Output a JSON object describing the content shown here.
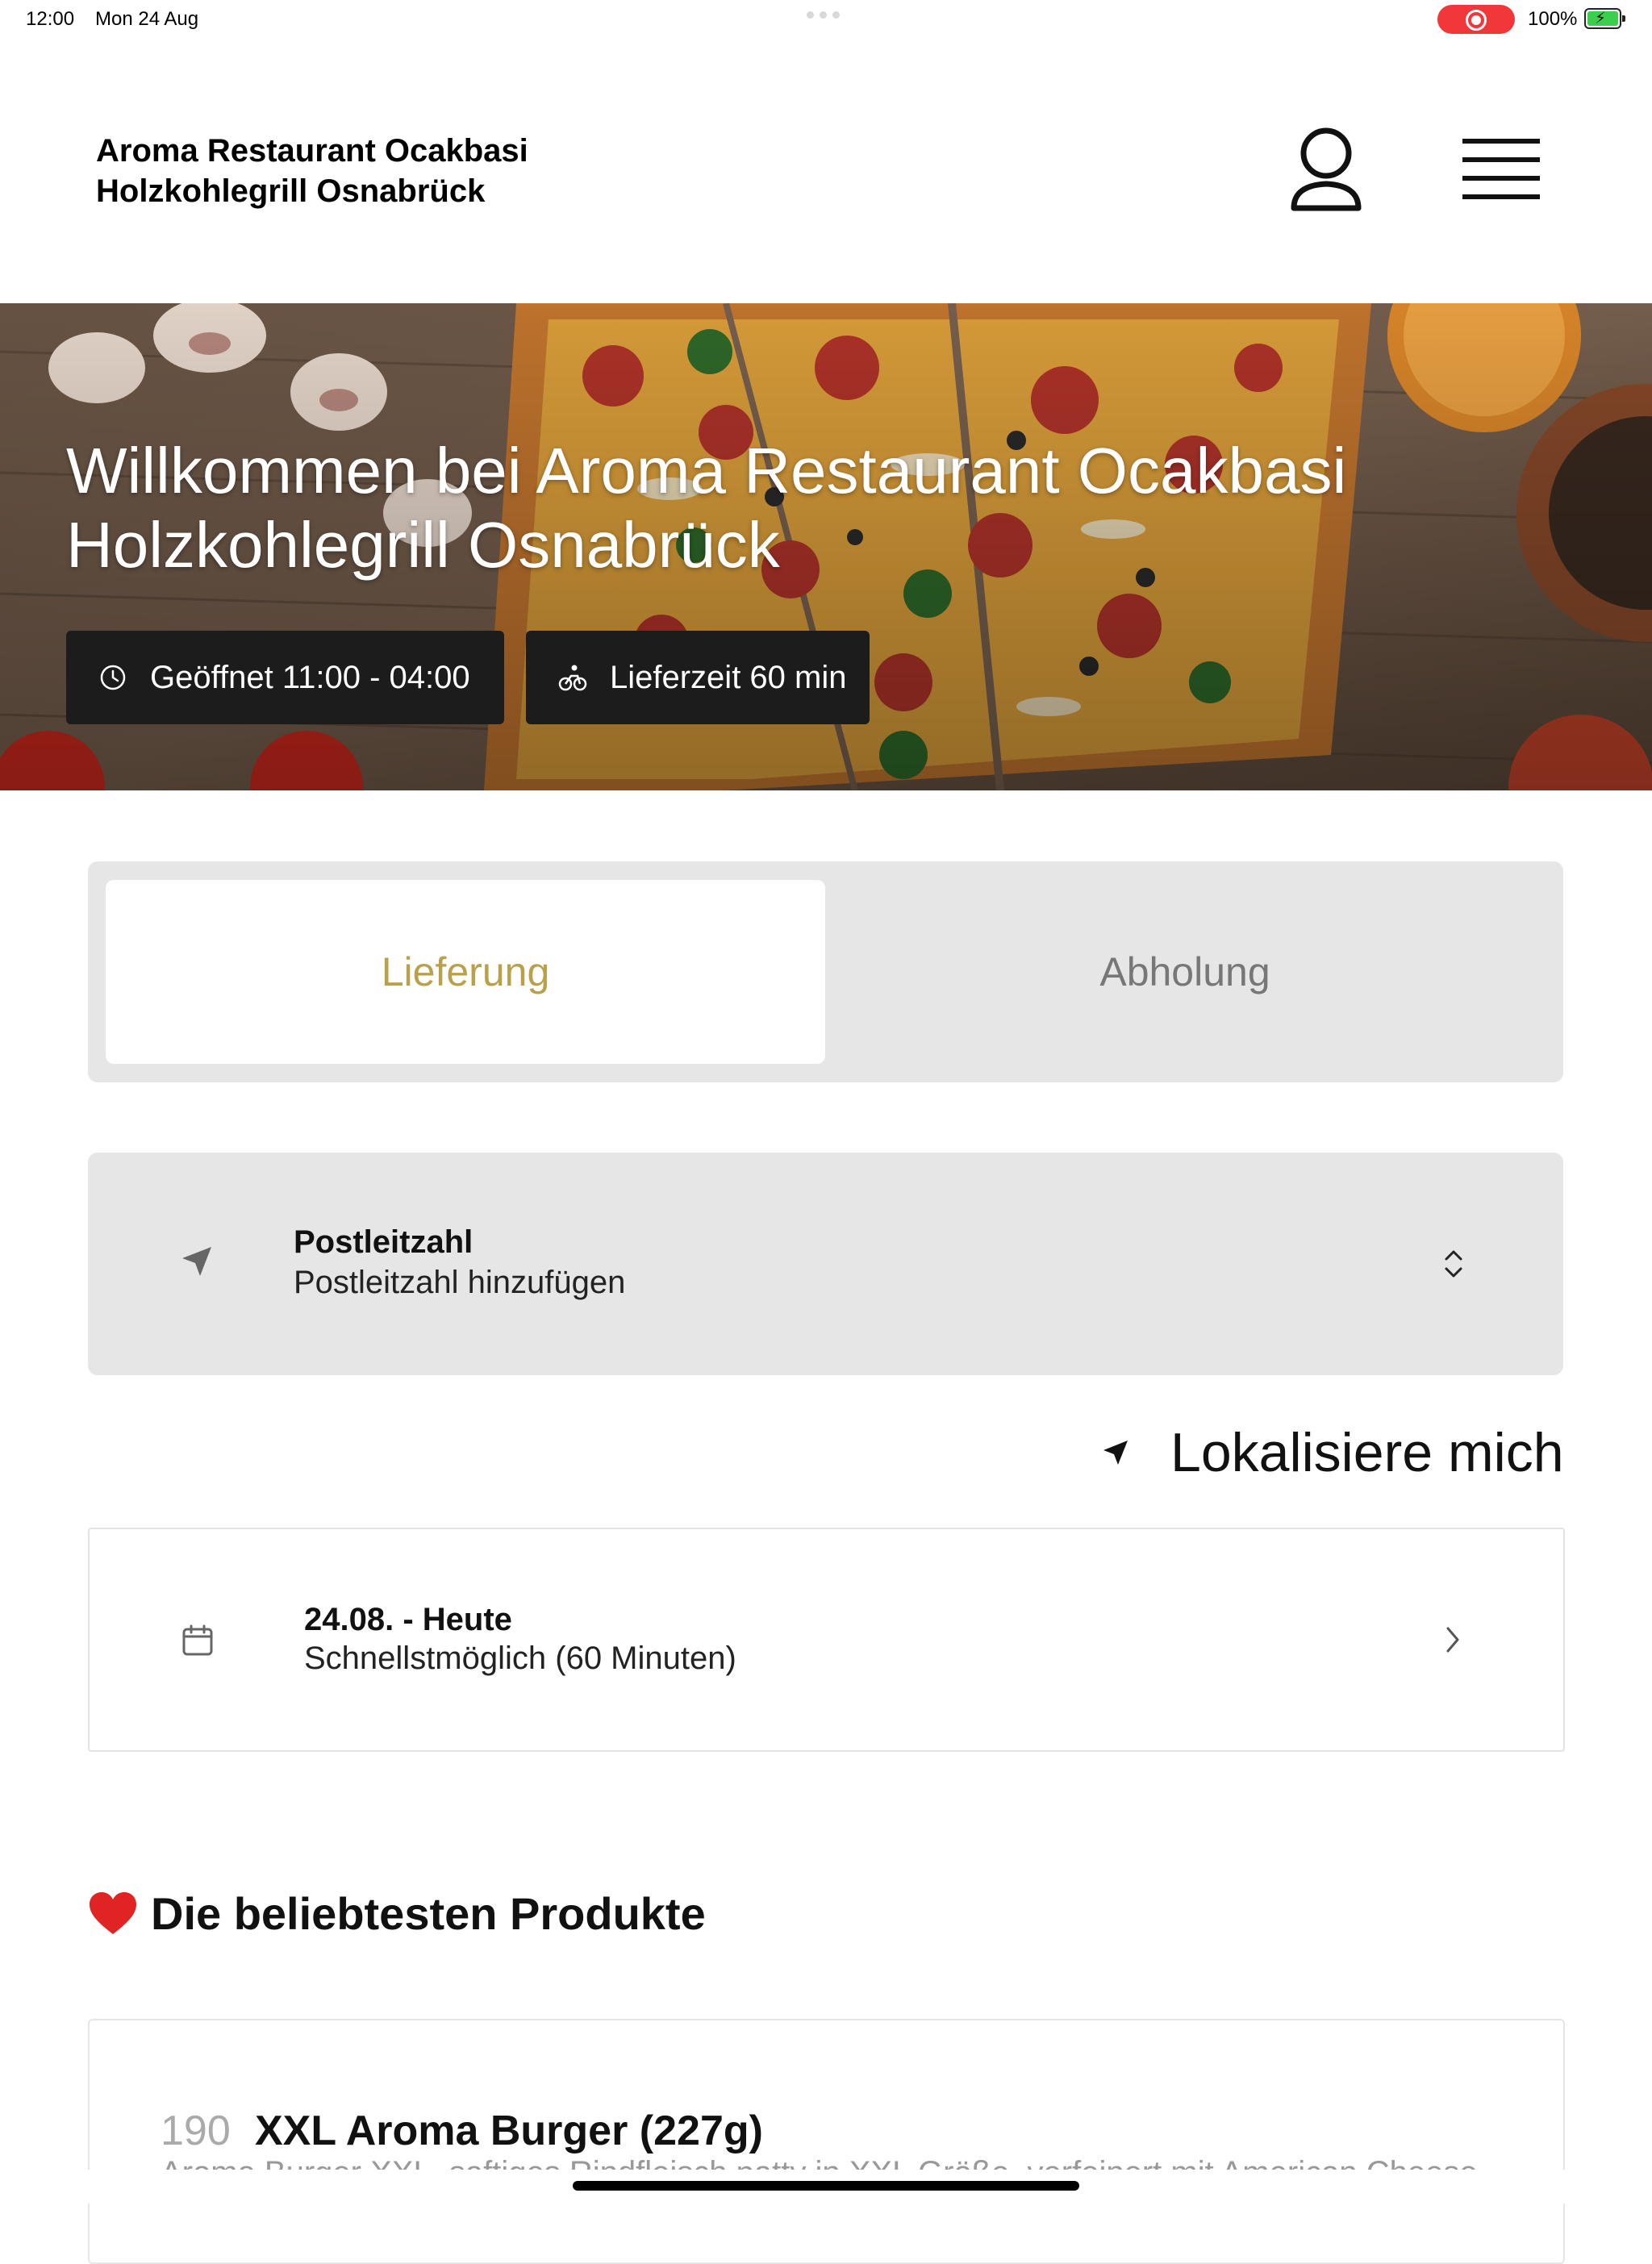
{
  "status_bar": {
    "time": "12:00",
    "date": "Mon 24 Aug",
    "battery": "100%"
  },
  "header": {
    "brand_line1": "Aroma Restaurant Ocakbasi",
    "brand_line2": "Holzkohlegrill Osnabrück"
  },
  "hero": {
    "title_line1": "Willkommen bei Aroma Restaurant Ocakbasi",
    "title_line2": "Holzkohlegrill Osnabrück",
    "open_hours": "Geöffnet 11:00 - 04:00",
    "delivery_time": "Lieferzeit 60 min"
  },
  "order_type": {
    "tabs": [
      {
        "label": "Lieferung",
        "selected": true
      },
      {
        "label": "Abholung",
        "selected": false
      }
    ]
  },
  "postal_code": {
    "label": "Postleitzahl",
    "placeholder": "Postleitzahl hinzufügen"
  },
  "locate_me": "Lokalisiere mich",
  "delivery_date": {
    "label": "24.08. - Heute",
    "value": "Schnellstmöglich (60 Minuten)"
  },
  "popular": {
    "title": "Die beliebtesten Produkte",
    "products": [
      {
        "number": "190",
        "name": "XXL Aroma Burger (227g)",
        "description": "Aroma Burger XXL, saftiges Rindfleisch patty in XXL Größe, verfeinert mit American Cheese"
      }
    ]
  },
  "colors": {
    "accent": "#b9a04a",
    "chip_bg": "#1c1c1c",
    "panel_bg": "#e6e6e6",
    "record_red": "#f2373b"
  }
}
